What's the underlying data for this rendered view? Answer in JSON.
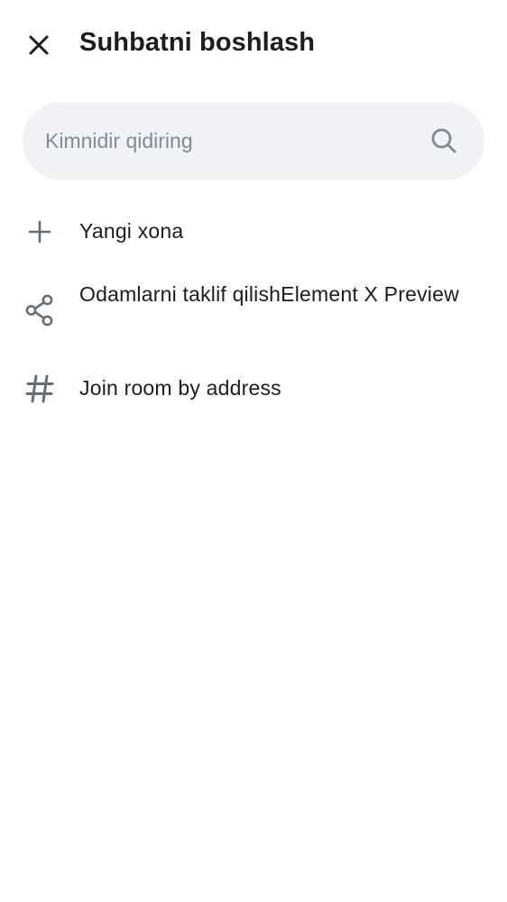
{
  "header": {
    "title": "Suhbatni boshlash",
    "close_icon": "close-icon"
  },
  "search": {
    "placeholder": "Kimnidir qidiring",
    "value": "",
    "icon": "search-icon"
  },
  "menu": {
    "items": [
      {
        "label": "Yangi xona",
        "icon": "plus-icon"
      },
      {
        "label": "Odamlarni taklif qilishElement X Preview",
        "icon": "share-icon"
      },
      {
        "label": "Join room by address",
        "icon": "hash-icon"
      }
    ]
  },
  "colors": {
    "text_primary": "#1b1d22",
    "icon": "#656d77",
    "search_bg": "#f0f2f5",
    "placeholder": "#818a95",
    "background": "#ffffff"
  }
}
